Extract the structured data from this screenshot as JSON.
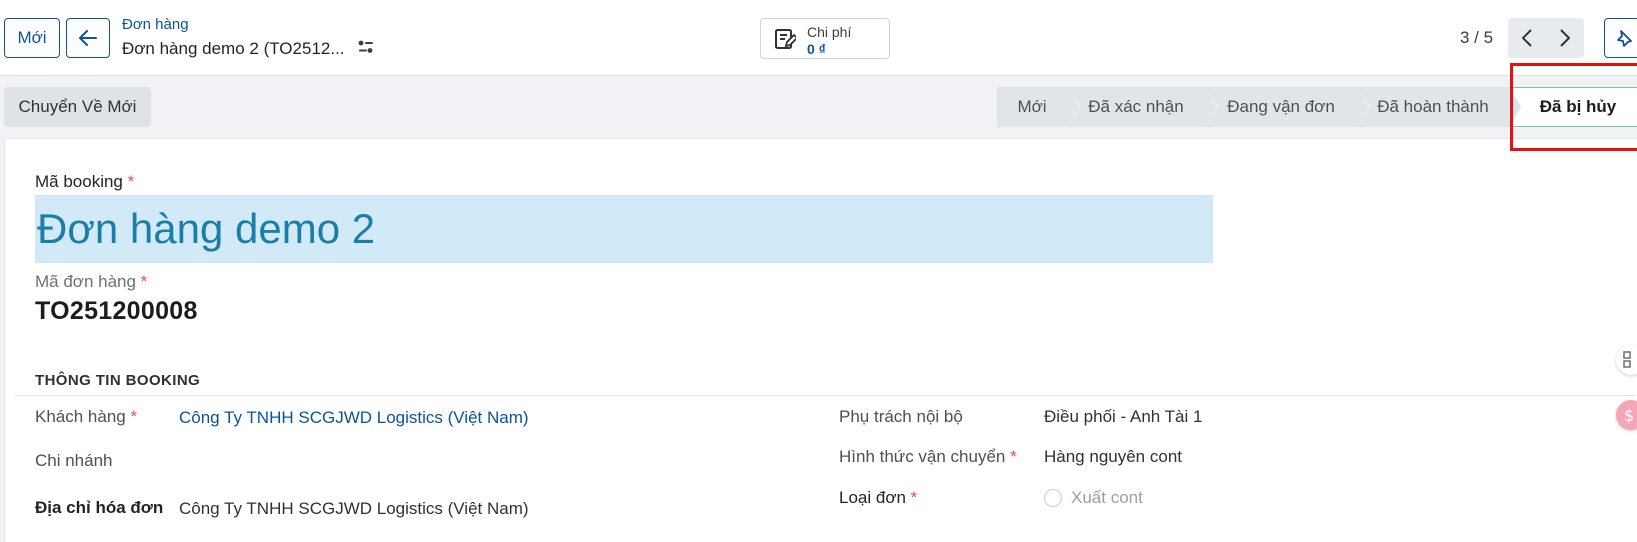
{
  "header": {
    "new_label": "Mới",
    "breadcrumb_parent": "Đơn hàng",
    "breadcrumb_current": "Đơn hàng demo 2 (TO2512...",
    "expense_label": "Chi phí",
    "expense_value": "0 ₫",
    "pager": "3 / 5"
  },
  "statusbar": {
    "reset_label": "Chuyển Về Mới",
    "stages": [
      "Mới",
      "Đã xác nhận",
      "Đang vận đơn",
      "Đã hoàn thành",
      "Đã bị hủy"
    ],
    "active_stage": "Đã bị hủy"
  },
  "form": {
    "booking_label": "Mã booking",
    "booking_value": "Đơn hàng demo 2",
    "order_code_label": "Mã đơn hàng",
    "order_code_value": "TO251200008",
    "section_title": "THÔNG TIN BOOKING",
    "customer_label": "Khách hàng",
    "customer_value": "Công Ty TNHH SCGJWD Logistics (Việt Nam)",
    "branch_label": "Chi nhánh",
    "invoice_address_label": "Địa chỉ hóa đơn",
    "invoice_address_value": "Công Ty TNHH SCGJWD Logistics (Việt Nam)",
    "internal_owner_label": "Phụ trách nội bộ",
    "internal_owner_value": "Điều phối - Anh Tài 1",
    "transport_mode_label": "Hình thức vận chuyển",
    "transport_mode_value": "Hàng nguyên cont",
    "order_type_label": "Loại đơn",
    "order_type_option": "Xuất cont"
  },
  "colors": {
    "primary": "#0b5394",
    "title_text": "#1a7fa6",
    "title_bg": "#d2e9f7",
    "highlight": "#e3110f",
    "required": "#d9534f"
  }
}
